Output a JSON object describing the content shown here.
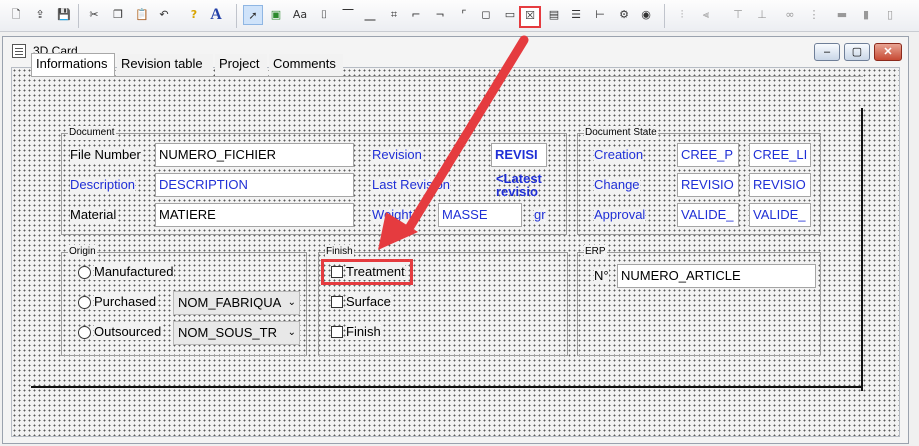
{
  "toolbar": {
    "font_a": "Aa",
    "font_big_a": "A",
    "help": "?"
  },
  "window": {
    "title": "3D Card"
  },
  "tabs": [
    {
      "label": "Informations"
    },
    {
      "label": "Revision table"
    },
    {
      "label": "Project"
    },
    {
      "label": "Comments"
    }
  ],
  "document": {
    "legend": "Document",
    "file_number_label": "File Number",
    "file_number_value": "NUMERO_FICHIER",
    "description_label": "Description",
    "description_value": "DESCRIPTION",
    "material_label": "Material",
    "material_value": "MATIERE",
    "revision_label": "Revision",
    "revision_value": "REVISI",
    "last_revision_label": "Last Revision",
    "last_revision_value": "<Latest",
    "last_revision_value2": "revisio",
    "weight_label": "Weight",
    "weight_value": "MASSE",
    "weight_unit": "gr"
  },
  "document_state": {
    "legend": "Document State",
    "rows": [
      {
        "label": "Creation",
        "v1": "CREE_P",
        "v2": "CREE_LI"
      },
      {
        "label": "Change",
        "v1": "REVISIO",
        "v2": "REVISIO"
      },
      {
        "label": "Approval",
        "v1": "VALIDE_",
        "v2": "VALIDE_"
      }
    ]
  },
  "origin": {
    "legend": "Origin",
    "manufactured": "Manufactured",
    "purchased": "Purchased",
    "purchased_combo": "NOM_FABRIQUA",
    "outsourced": "Outsourced",
    "outsourced_combo": "NOM_SOUS_TR"
  },
  "finish": {
    "legend": "Finish",
    "treatment": "Treatment",
    "surface": "Surface",
    "finish": "Finish"
  },
  "erp": {
    "legend": "ERP",
    "n_label": "N°",
    "n_value": "NUMERO_ARTICLE"
  },
  "colors": {
    "accent_blue": "#1f2fd6",
    "highlight_red": "#e53b3f"
  }
}
